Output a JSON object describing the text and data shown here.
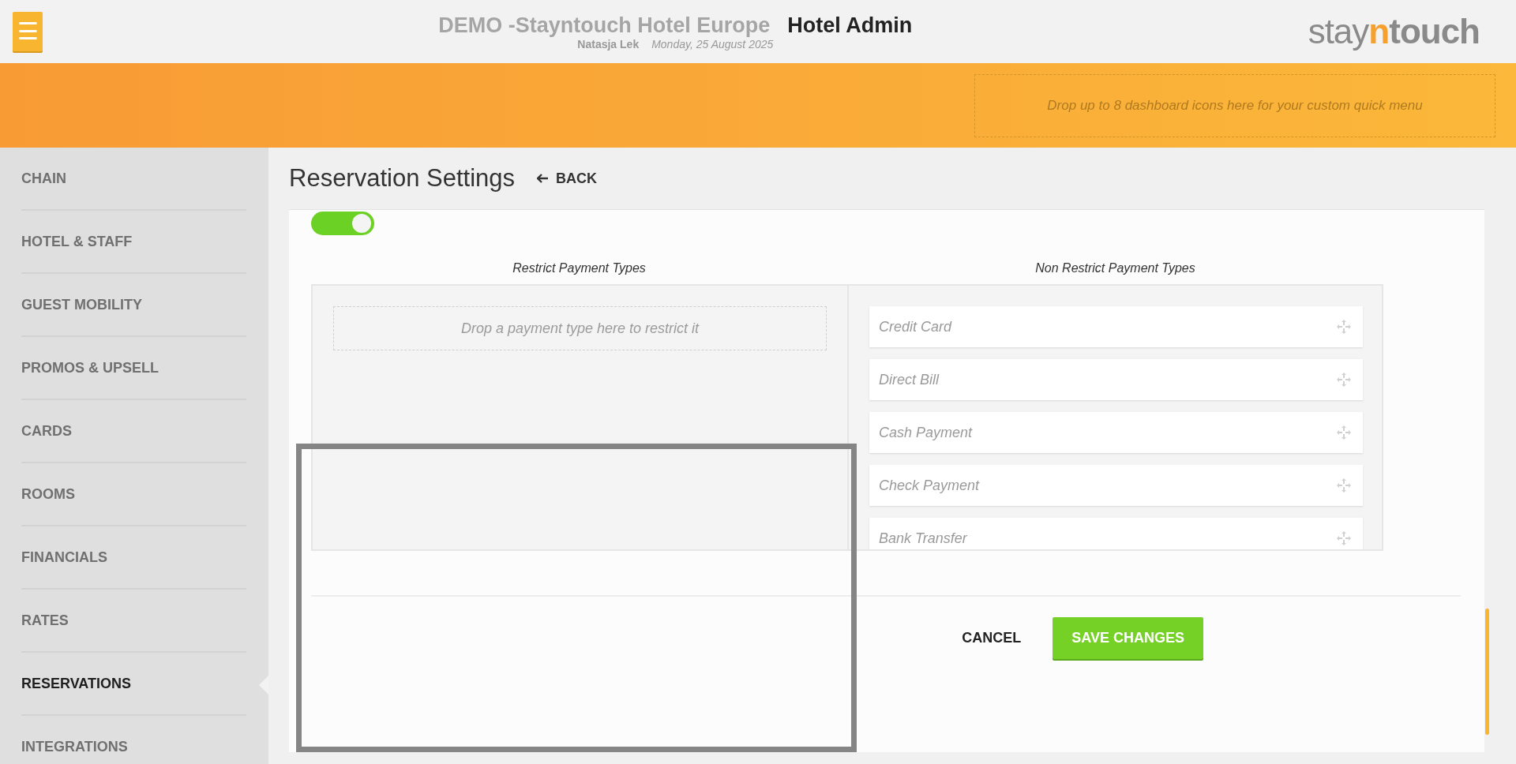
{
  "header": {
    "menu_button": "☰",
    "title": "DEMO -Stayntouch Hotel Europe",
    "subtitle": "Hotel Admin",
    "user": "Natasja Lek",
    "date": "Monday, 25 August 2025",
    "logo": [
      {
        "text": "stay",
        "kind": "light"
      },
      {
        "text": "n",
        "kind": "accent"
      },
      {
        "text": "touch",
        "kind": "bold"
      }
    ]
  },
  "quick_menu": {
    "placeholder": "Drop up to 8 dashboard icons here for your custom quick menu"
  },
  "sidebar": {
    "items": [
      {
        "label": "CHAIN",
        "selected": false
      },
      {
        "label": "HOTEL & STAFF",
        "selected": false
      },
      {
        "label": "GUEST MOBILITY",
        "selected": false
      },
      {
        "label": "PROMOS & UPSELL",
        "selected": false
      },
      {
        "label": "CARDS",
        "selected": false
      },
      {
        "label": "ROOMS",
        "selected": false
      },
      {
        "label": "FINANCIALS",
        "selected": false
      },
      {
        "label": "RATES",
        "selected": false
      },
      {
        "label": "RESERVATIONS",
        "selected": true
      },
      {
        "label": "INTEGRATIONS",
        "selected": false
      }
    ]
  },
  "page": {
    "title": "Reservation Settings",
    "back": "BACK",
    "toggle": {
      "on": true
    },
    "restrict": {
      "heading": "Restrict Payment Types",
      "drop_hint": "Drop a payment type here to restrict it"
    },
    "non_restrict": {
      "heading": "Non Restrict Payment Types",
      "items": [
        "Credit Card",
        "Direct Bill",
        "Cash Payment",
        "Check Payment",
        "Bank Transfer"
      ]
    },
    "buttons": {
      "cancel": "CANCEL",
      "save": "SAVE CHANGES"
    }
  }
}
